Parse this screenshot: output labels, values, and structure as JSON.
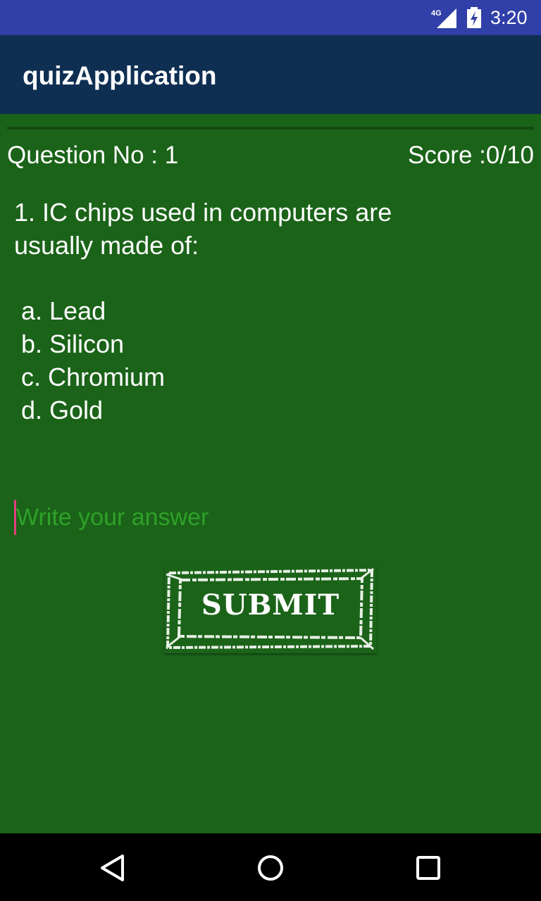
{
  "status_bar": {
    "network": "4G",
    "time": "3:20",
    "icons": [
      "signal-icon",
      "battery-charging-icon"
    ]
  },
  "app_bar": {
    "title": "quizApplication"
  },
  "quiz": {
    "question_no_label": "Question No : 1",
    "score_label": "Score :0/10",
    "question_line1": "1. IC chips used in computers are",
    "question_line2": "usually made of:",
    "options": [
      "a. Lead",
      "b. Silicon",
      "c. Chromium",
      "d. Gold"
    ],
    "answer_value": "",
    "answer_placeholder": "Write your answer",
    "submit_label": "SUBMIT"
  },
  "nav_bar": {
    "icons": [
      "back-icon",
      "home-icon",
      "recents-icon"
    ]
  },
  "colors": {
    "status_bar": "#3140a8",
    "app_bar": "#0f2f52",
    "background": "#1b6319",
    "placeholder": "#2fa12a",
    "cursor": "#e0407c"
  }
}
